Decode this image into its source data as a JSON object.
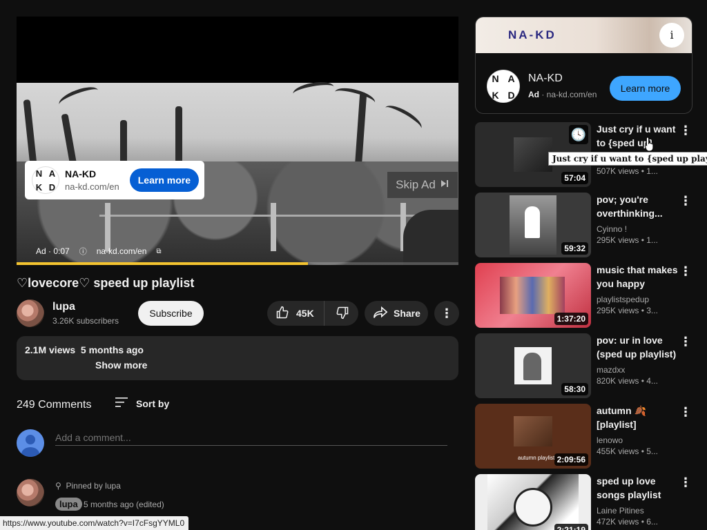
{
  "player": {
    "ad_overlay": {
      "brand": "NA-KD",
      "domain": "na-kd.com/en",
      "cta": "Learn more",
      "logo_letters": [
        "N",
        "A",
        "K",
        "D"
      ]
    },
    "skip_ad": "Skip Ad",
    "ad_info": {
      "time": "Ad · 0:07",
      "domain": "na-kd.com/en"
    },
    "progress": 0.66,
    "accent_color": "#f4c430"
  },
  "video": {
    "title": "♡lovecore♡ speed up playlist"
  },
  "channel": {
    "name": "lupa",
    "subscribers": "3.26K subscribers",
    "subscribe_label": "Subscribe"
  },
  "actions": {
    "likes": "45K",
    "share": "Share"
  },
  "description": {
    "meta": "2.1M views  5 months ago",
    "show_more": "Show more"
  },
  "comments": {
    "count": "249 Comments",
    "sort_by": "Sort by",
    "placeholder": "Add a comment...",
    "pinned": {
      "pinned_by": "Pinned by lupa",
      "author": "lupa",
      "time": "5 months ago (edited)"
    }
  },
  "status_url": "https://www.youtube.com/watch?v=I7cFsgYYML0",
  "ad_card": {
    "banner_logo": "NA-KD",
    "brand": "NA-KD",
    "ad_label": "Ad",
    "domain": "na-kd.com/en",
    "cta": "Learn more",
    "logo_letters": [
      "N",
      "A",
      "K",
      "D"
    ],
    "cta_color": "#3ea6ff"
  },
  "recommendations": [
    {
      "title": "Just cry if u want to {sped up}",
      "channel": "",
      "views": "507K views",
      "age": "1...",
      "duration": "57:04"
    },
    {
      "title": "pov; you're overthinking...",
      "channel": "Cyinno !",
      "views": "295K views",
      "age": "1...",
      "duration": "59:32"
    },
    {
      "title": "music that makes you happy playli...",
      "channel": "playlistspedup",
      "views": "295K views",
      "age": "3...",
      "duration": "1:37:20"
    },
    {
      "title": "pov: ur in love (sped up playlist)",
      "channel": "mazdxx",
      "views": "820K views",
      "age": "4...",
      "duration": "58:30"
    },
    {
      "title": "autumn 🍂 [playlist]",
      "channel": "lenowo",
      "views": "455K views",
      "age": "5...",
      "duration": "2:09:56",
      "thumb_caption": "autumn playlist"
    },
    {
      "title": "sped up love songs playlist",
      "channel": "Laine Pitines",
      "views": "472K views",
      "age": "6...",
      "duration": "2:21:19"
    }
  ],
  "tooltip": "Just cry if u want to {sped up playlist}"
}
